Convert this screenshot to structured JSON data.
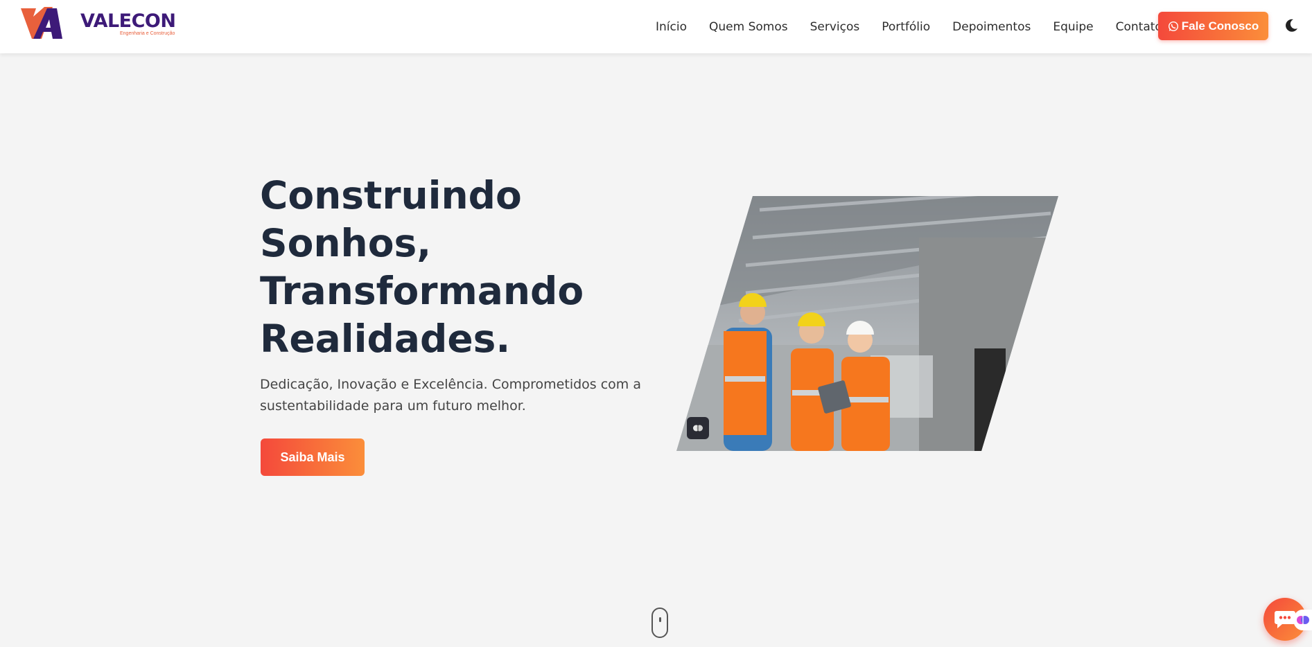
{
  "brand": {
    "name": "VALECON",
    "tagline": "Engenharia e Construção",
    "colors": {
      "primary": "#3d1a78",
      "accent": "#e8603c"
    }
  },
  "nav": {
    "items": [
      {
        "label": "Início"
      },
      {
        "label": "Quem Somos"
      },
      {
        "label": "Serviços"
      },
      {
        "label": "Portfólio"
      },
      {
        "label": "Depoimentos"
      },
      {
        "label": "Equipe"
      },
      {
        "label": "Contato"
      }
    ],
    "cta_label": "Fale Conosco",
    "cta_icon": "whatsapp-icon",
    "theme_toggle_icon": "moon-icon"
  },
  "hero": {
    "title": "Construindo Sonhos, Transformando Realidades.",
    "subtitle": "Dedicação, Inovação e Excelência. Comprometidos com a sustentabilidade para um futuro melhor.",
    "button_label": "Saiba Mais",
    "image_icon": "brain-icon"
  },
  "floating": {
    "chat_icon": "chat-bubble-icon",
    "ai_icon": "brain-icon",
    "scroll_icon": "mouse-scroll-icon"
  },
  "theme": {
    "gradient_start": "#f4493b",
    "gradient_end": "#fb8e3a",
    "background": "#f4f4f4",
    "heading": "#1f2a3c"
  }
}
